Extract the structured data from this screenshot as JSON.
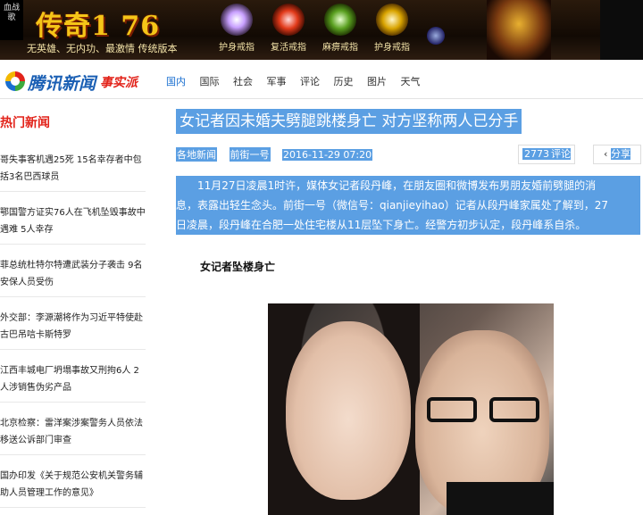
{
  "banner": {
    "side_label": "血战\n歌",
    "game_title": "传奇1 76",
    "slogan": "无英雄、无内功、最激情 传统版本",
    "items": [
      {
        "label": "护身戒指",
        "icon": "ring-icon"
      },
      {
        "label": "复活戒指",
        "icon": "ring-icon"
      },
      {
        "label": "麻痹戒指",
        "icon": "ring-icon"
      },
      {
        "label": "护身戒指",
        "icon": "ring-icon"
      }
    ]
  },
  "header": {
    "logo_text": "腾讯新闻",
    "logo_tag": "事实派",
    "nav": [
      "国内",
      "国际",
      "社会",
      "军事",
      "评论",
      "历史",
      "图片",
      "天气"
    ]
  },
  "sidebar": {
    "title": "热门新闻",
    "items": [
      "哥失事客机遇25死 15名幸存者中包括3名巴西球员",
      "鄂国警方证实76人在飞机坠毁事故中遇难 5人幸存",
      "菲总统杜特尔特遭武装分子袭击 9名安保人员受伤",
      "外交部：李源潮将作为习近平特使赴古巴吊唁卡斯特罗",
      "江西丰城电厂坍塌事故又刑拘6人 2人涉销售伪劣产品",
      "北京检察：雷洋案涉案警务人员依法移送公诉部门审查",
      "国办印发《关于规范公安机关警务辅助人员管理工作的意见》"
    ]
  },
  "article": {
    "title": "女记者因未婚夫劈腿跳楼身亡 对方坚称两人已分手",
    "source": "各地新闻",
    "author": "前街一号",
    "datetime": "2016-11-29 07:20",
    "comment_count": "2773",
    "comment_label": "评论",
    "share_label": "分享",
    "lead_lines": [
      "　　11月27日凌晨1时许，媒体女记者段丹峰，在朋友圈和微博发布男朋友婚前劈腿的消",
      "息，表露出轻生念头。前街一号（微信号：qianjieyihao）记者从段丹峰家属处了解到，27",
      "日凌晨，段丹峰在合肥一处住宅楼从11层坠下身亡。经警方初步认定，段丹峰系自杀。"
    ],
    "subheading": "女记者坠楼身亡"
  }
}
